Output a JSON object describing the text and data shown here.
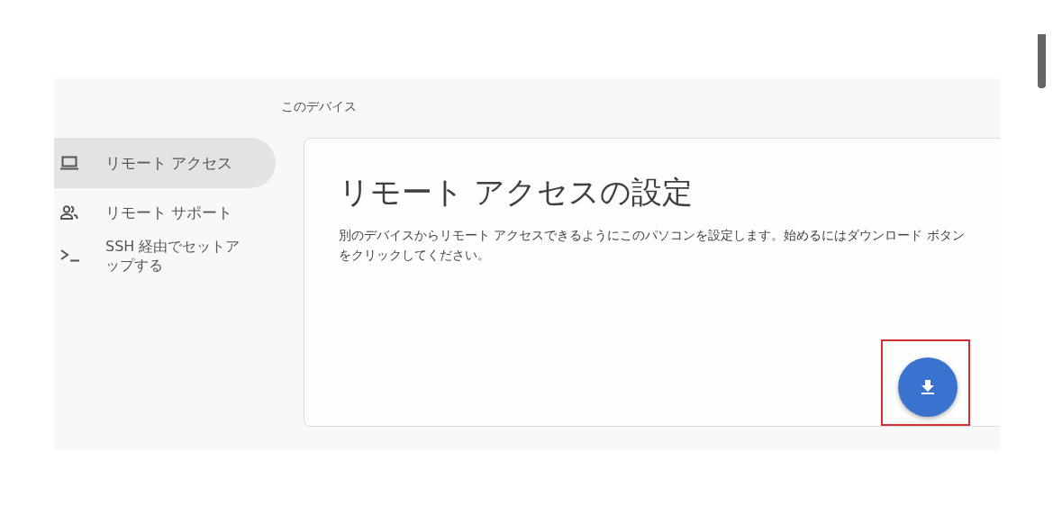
{
  "sidebar": {
    "items": [
      {
        "label": "リモート アクセス",
        "kind": "laptop",
        "selected": true
      },
      {
        "label": "リモート サポート",
        "kind": "people",
        "selected": false
      },
      {
        "label": "SSH 経由でセットアップする",
        "kind": "terminal",
        "selected": false
      }
    ]
  },
  "section_heading": "このデバイス",
  "card": {
    "title": "リモート アクセスの設定",
    "description": "別のデバイスからリモート アクセスできるようにこのパソコンを設定します。始めるにはダウンロード ボタンをクリックしてください。",
    "download_button": {
      "highlighted": true
    }
  }
}
